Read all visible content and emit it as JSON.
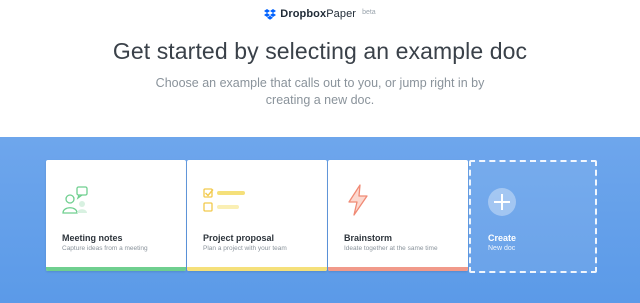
{
  "brand": {
    "name_bold": "Dropbox",
    "name_light": "Paper",
    "badge": "beta",
    "logo_icon": "dropbox-logo-icon"
  },
  "hero": {
    "title": "Get started by selecting an example doc",
    "subtitle": "Choose an example that calls out to you, or jump right in by creating a new doc."
  },
  "templates": [
    {
      "title": "Meeting notes",
      "description": "Capture ideas from a meeting",
      "icon": "meeting-people-icon",
      "accent": "#6fcf8f"
    },
    {
      "title": "Project proposal",
      "description": "Plan a project with your team",
      "icon": "checklist-icon",
      "accent": "#f5e07a"
    },
    {
      "title": "Brainstorm",
      "description": "Ideate together at the same time",
      "icon": "lightning-icon",
      "accent": "#f19a8a"
    }
  ],
  "create": {
    "title": "Create",
    "description": "New doc",
    "icon": "plus-icon"
  },
  "colors": {
    "panel_blue": "#5f9de9",
    "brand_blue": "#0061fe"
  }
}
